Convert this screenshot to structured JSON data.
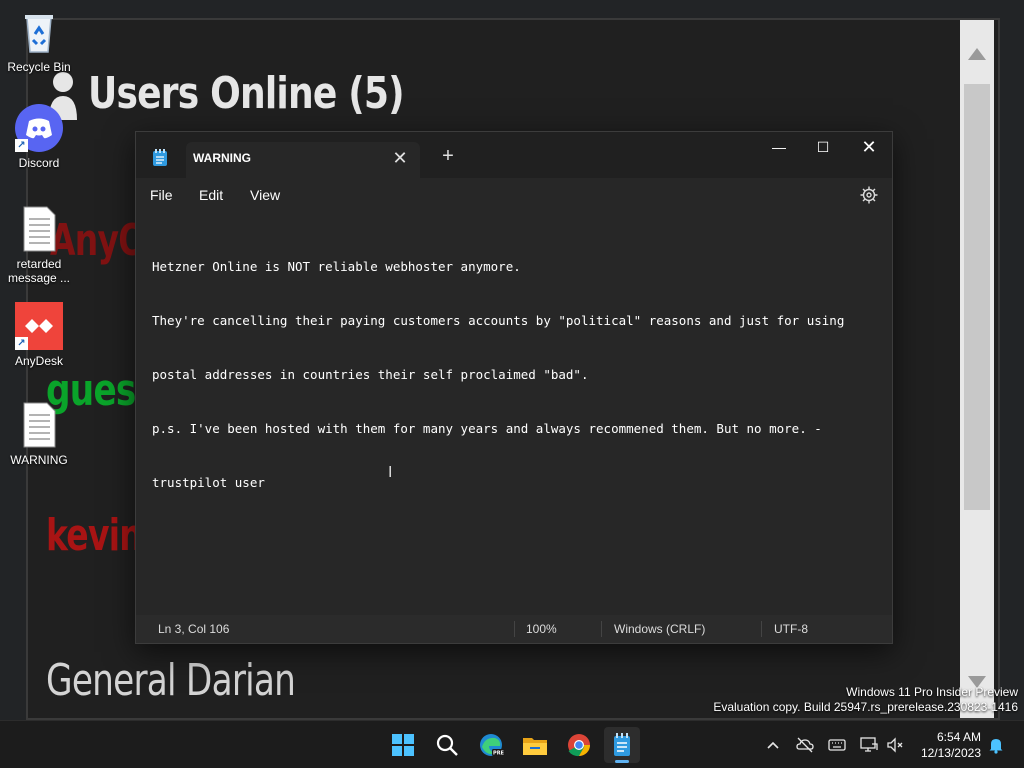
{
  "desktop": {
    "background_window": {
      "header_text": "Users Online (5)",
      "names": [
        "AnyO",
        "guest",
        "kevin",
        "General Darian"
      ]
    },
    "icons": [
      {
        "label": "Recycle Bin",
        "icon": "recycle-bin-icon"
      },
      {
        "label": "Discord",
        "icon": "discord-icon"
      },
      {
        "label": "retarded message ...",
        "icon": "text-file-icon"
      },
      {
        "label": "AnyDesk",
        "icon": "anydesk-icon"
      },
      {
        "label": "WARNING",
        "icon": "text-file-icon"
      }
    ]
  },
  "notepad": {
    "tab_title": "WARNING",
    "tab_close": "✕",
    "new_tab": "+",
    "window_controls": {
      "minimize": "—",
      "maximize": "☐",
      "close": "✕"
    },
    "menu": {
      "file": "File",
      "edit": "Edit",
      "view": "View"
    },
    "content_lines": [
      "Hetzner Online is NOT reliable webhoster anymore.",
      "They're cancelling their paying customers accounts by \"political\" reasons and just for using",
      "postal addresses in countries their self proclaimed \"bad\".",
      "p.s. I've been hosted with them for many years and always recommened them. But no more. -",
      "trustpilot user"
    ],
    "status": {
      "position": "Ln 3, Col 106",
      "zoom": "100%",
      "line_endings": "Windows (CRLF)",
      "encoding": "UTF-8"
    }
  },
  "watermark": {
    "line1": "Windows 11 Pro Insider Preview",
    "line2": "Evaluation copy. Build 25947.rs_prerelease.230823-1416"
  },
  "taskbar": {
    "apps": [
      "start-icon",
      "search-icon",
      "edge-icon",
      "file-explorer-icon",
      "chrome-icon",
      "notepad-icon"
    ],
    "clock": {
      "time": "6:54 AM",
      "date": "12/13/2023"
    }
  },
  "colors": {
    "notepad_bg": "#272727",
    "titlebar_bg": "#202020",
    "taskbar_bg": "#1c1c1c",
    "accent": "#5fb2f2",
    "guest_green": "#0aa42a",
    "kevin_red": "#a81414"
  }
}
